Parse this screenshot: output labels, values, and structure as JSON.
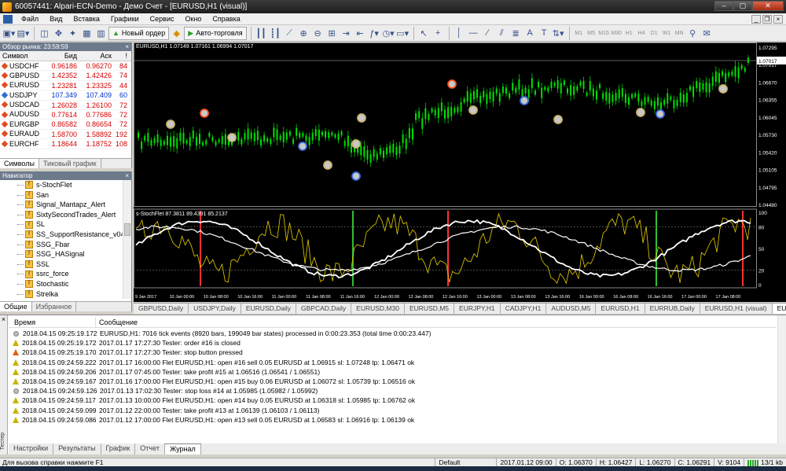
{
  "window": {
    "title": "60057441: Alpari-ECN-Demo - Демо Счет - [EURUSD,H1 (visual)]"
  },
  "menu": [
    "Файл",
    "Вид",
    "Вставка",
    "Графики",
    "Сервис",
    "Окно",
    "Справка"
  ],
  "toolbar": {
    "new_order": "Новый ордер",
    "autotrading": "Авто-торговля",
    "timeframes": [
      "M1",
      "M5",
      "M15",
      "M30",
      "H1",
      "H4",
      "D1",
      "W1",
      "MN"
    ]
  },
  "market_watch": {
    "header": "Обзор рынка: 23:59:59",
    "columns": [
      "Символ",
      "Бид",
      "Аск",
      "!"
    ],
    "rows": [
      {
        "symbol": "USDCHF",
        "bid": "0.96186",
        "ask": "0.96270",
        "spread": "84",
        "color": "red"
      },
      {
        "symbol": "GBPUSD",
        "bid": "1.42352",
        "ask": "1.42426",
        "spread": "74",
        "color": "red"
      },
      {
        "symbol": "EURUSD",
        "bid": "1.23281",
        "ask": "1.23325",
        "spread": "44",
        "color": "red"
      },
      {
        "symbol": "USDJPY",
        "bid": "107.349",
        "ask": "107.409",
        "spread": "60",
        "color": "blue"
      },
      {
        "symbol": "USDCAD",
        "bid": "1.26028",
        "ask": "1.26100",
        "spread": "72",
        "color": "red"
      },
      {
        "symbol": "AUDUSD",
        "bid": "0.77614",
        "ask": "0.77686",
        "spread": "72",
        "color": "red"
      },
      {
        "symbol": "EURGBP",
        "bid": "0.86582",
        "ask": "0.86654",
        "spread": "72",
        "color": "red"
      },
      {
        "symbol": "EURAUD",
        "bid": "1.58700",
        "ask": "1.58892",
        "spread": "192",
        "color": "red"
      },
      {
        "symbol": "EURCHF",
        "bid": "1.18644",
        "ask": "1.18752",
        "spread": "108",
        "color": "red"
      }
    ],
    "tabs": [
      "Символы",
      "Тиковый график"
    ]
  },
  "navigator": {
    "header": "Навигатор",
    "items": [
      "s-StochFlet",
      "San",
      "Signal_Mantapz_Alert",
      "SixtySecondTrades_Alert",
      "SL",
      "SS_SupportResistance_v04c",
      "SSG_Fbar",
      "SSG_HASignal",
      "SSL",
      "ssrc_force",
      "Stochastic",
      "Strelka"
    ],
    "tabs": [
      "Общие",
      "Избранное"
    ]
  },
  "chart": {
    "main_label": "EURUSD,H1  1.07149 1.07161 1.06994 1.07017",
    "indicator_label": "s-StochFlet 87.3811 89.4391 85.2137",
    "price_ticks": [
      "1.07295",
      "1.07017",
      "1.06670",
      "1.06355",
      "1.06045",
      "1.05730",
      "1.05420",
      "1.05105",
      "1.04795",
      "1.04480"
    ],
    "current_price": "1.07017",
    "osc_ticks": [
      "100",
      "80",
      "50",
      "20",
      "0"
    ],
    "time_ticks": [
      "9 Jan 2017",
      "10 Jan 00:00",
      "10 Jan 08:00",
      "10 Jan 16:00",
      "11 Jan 00:00",
      "11 Jan 08:00",
      "11 Jan 16:00",
      "12 Jan 00:00",
      "12 Jan 08:00",
      "12 Jan 16:00",
      "13 Jan 00:00",
      "13 Jan 08:00",
      "13 Jan 16:00",
      "16 Jan 00:00",
      "16 Jan 08:00",
      "16 Jan 16:00",
      "17 Jan 00:00",
      "17 Jan 08:00"
    ]
  },
  "chart_tabs": [
    "GBPUSD,Daily",
    "USDJPY,Daily",
    "EURUSD,Daily",
    "GBPCAD,Daily",
    "EURUSD,M30",
    "EURUSD,M5",
    "EURJPY,H1",
    "CADJPY,H1",
    "AUDUSD,M5",
    "EURUSD,H1",
    "EURRUB,Daily",
    "EURUSD,H1 (visual)",
    "EURUS"
  ],
  "terminal": {
    "columns": [
      "Время",
      "Сообщение"
    ],
    "rows": [
      {
        "type": "info",
        "time": "2018.04.15 09:25:19.172",
        "msg": "EURUSD,H1: 7016 tick events (8920 bars, 199049 bar states) processed in 0:00:23.353 (total time 0:00:23.447)"
      },
      {
        "type": "warn",
        "time": "2018.04.15 09:25:19.172",
        "msg": "2017.01.17 17:27:30  Tester: order #16 is closed"
      },
      {
        "type": "err",
        "time": "2018.04.15 09:25:19.170",
        "msg": "2017.01.17 17:27:30  Tester: stop button pressed"
      },
      {
        "type": "warn",
        "time": "2018.04.15 09:24:59.222",
        "msg": "2017.01.17 16:00:00  Flet EURUSD,H1: open #16 sell 0.05 EURUSD at 1.06915 sl: 1.07248 tp: 1.06471 ok"
      },
      {
        "type": "warn",
        "time": "2018.04.15 09:24:59.206",
        "msg": "2017.01.17 07:45:00  Tester: take profit #15 at 1.06516 (1.06541 / 1.06551)"
      },
      {
        "type": "warn",
        "time": "2018.04.15 09:24:59.167",
        "msg": "2017.01.16 17:00:00  Flet EURUSD,H1: open #15 buy 0.06 EURUSD at 1.06072 sl: 1.05739 tp: 1.06516 ok"
      },
      {
        "type": "info",
        "time": "2018.04.15 09:24:59.126",
        "msg": "2017.01.13 17:02:30  Tester: stop loss #14 at 1.05985 (1.05982 / 1.05992)"
      },
      {
        "type": "warn",
        "time": "2018.04.15 09:24:59.117",
        "msg": "2017.01.13 10:00:00  Flet EURUSD,H1: open #14 buy 0.05 EURUSD at 1.06318 sl: 1.05985 tp: 1.06762 ok"
      },
      {
        "type": "warn",
        "time": "2018.04.15 09:24:59.099",
        "msg": "2017.01.12 22:00:00  Tester: take profit #13 at 1.06139 (1.06103 / 1.06113)"
      },
      {
        "type": "warn",
        "time": "2018.04.15 09:24:59.086",
        "msg": "2017.01.12 17:00:00  Flet EURUSD,H1: open #13 sell 0.05 EURUSD at 1.06583 sl: 1.06916 tp: 1.06139 ok"
      }
    ],
    "tabs": [
      "Настройки",
      "Результаты",
      "График",
      "Отчет",
      "Журнал"
    ],
    "side_label": "Тестер"
  },
  "status": {
    "help": "Для вызова справки нажмите F1",
    "profile": "Default",
    "datetime": "2017.01.12 09:00",
    "open": "O: 1.06370",
    "high": "H: 1.06427",
    "low": "L: 1.06270",
    "close": "C: 1.06291",
    "volume": "V: 9104",
    "traffic": "13/1 kb"
  }
}
